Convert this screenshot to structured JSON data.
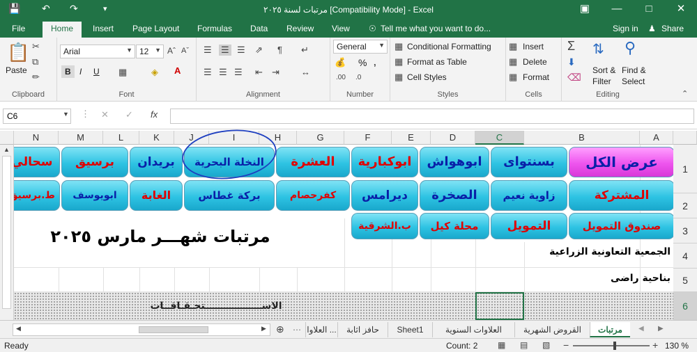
{
  "titlebar": {
    "title": "مرتبات لسنة ٢٠٢٥  [Compatibility Mode] - Excel",
    "save_icon": "save-icon",
    "undo_icon": "undo-icon",
    "redo_icon": "redo-icon"
  },
  "tabs": [
    "File",
    "Home",
    "Insert",
    "Page Layout",
    "Formulas",
    "Data",
    "Review",
    "View"
  ],
  "tell_me": "Tell me what you want to do...",
  "sign_in": "Sign in",
  "share": "Share",
  "ribbon": {
    "clipboard": {
      "paste": "Paste",
      "label": "Clipboard"
    },
    "font": {
      "name": "Arial",
      "size": "12",
      "label": "Font",
      "bold": "B",
      "italic": "I",
      "underline": "U"
    },
    "alignment": {
      "label": "Alignment"
    },
    "number": {
      "format": "General",
      "label": "Number",
      "percent": "%"
    },
    "styles": {
      "cond": "Conditional Formatting",
      "table": "Format as Table",
      "cell": "Cell Styles",
      "label": "Styles"
    },
    "cells": {
      "insert": "Insert",
      "delete": "Delete",
      "format": "Format",
      "label": "Cells"
    },
    "editing": {
      "sort": "Sort &",
      "filter": "Filter",
      "find": "Find &",
      "select": "Select",
      "label": "Editing"
    }
  },
  "formula_bar": {
    "name_box": "C6",
    "formula": ""
  },
  "columns": [
    "A",
    "B",
    "C",
    "D",
    "E",
    "F",
    "G",
    "H",
    "I",
    "J",
    "K",
    "L",
    "M",
    "N"
  ],
  "rows": [
    "1",
    "2",
    "3",
    "4",
    "5",
    "6"
  ],
  "buttons_row1": [
    "عرض الكل",
    "بسنتواى",
    "ابوهواش",
    "ابوكبارية",
    "العشرة",
    "النخلة البحرية",
    "بريدان",
    "برسيق",
    "سحالي"
  ],
  "buttons_row2": [
    "المشتركة",
    "زاوية نعيم",
    "الصخرة",
    "ديرامس",
    "كفرحصام",
    "بركة غطاس",
    "الغابة",
    "ابويوسف",
    "ط.برسيق"
  ],
  "buttons_row3": [
    "صندوق التمويل",
    "التمويل",
    "محلة كيل",
    "ب.الشرقية"
  ],
  "sheet_title": "مرتبات شهـــر مارس ٢٠٢٥",
  "cell_b4": "الجمعية التعاونية الزراعية",
  "cell_b5": "بناحية راضى",
  "row6_text": "الاســـــــــــــــــتحـقـاقــات",
  "sheet_tabs": [
    "مرتبات",
    "القروض الشهرية",
    "العلاوات السنوية",
    "Sheet1",
    "حافز اثابة",
    "العلاوا ..."
  ],
  "status": {
    "ready": "Ready",
    "count": "Count: 2",
    "zoom": "130 %"
  }
}
